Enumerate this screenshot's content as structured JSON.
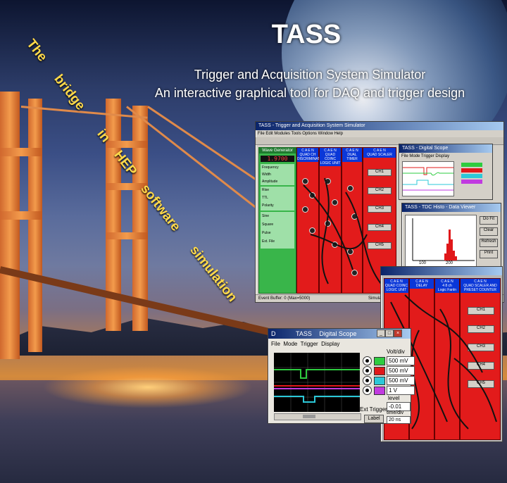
{
  "banner": {
    "title": "TASS",
    "subtitle_line1": "Trigger and Acquisition System Simulator",
    "subtitle_line2": "An interactive graphical tool for DAQ and trigger design",
    "slogan_words": [
      "The",
      "bridge",
      "in",
      "HEP",
      "software",
      "simulation"
    ]
  },
  "main_window": {
    "title": "TASS - Trigger and Acquisition System Simulator",
    "wave_generator_label": "Wave Generator",
    "wave_frequency_display": "1.9700",
    "wave_controls": [
      "Frequency",
      "Width",
      "Amplitude",
      "Rise",
      "TTL",
      "Polarity",
      "Sine",
      "Square",
      "Pulse",
      "Ext. File"
    ],
    "module_headers": [
      "C A E N\nQUAD CH\nDISCRIMINATOR",
      "C A E N\nQUAD COINC\nLOGIC UNIT",
      "C A E N\nDUAL TIMER",
      "C A E N\nQUAD SCALER"
    ],
    "channel_labels": [
      "CH1",
      "CH2",
      "CH3",
      "CH4",
      "CH5"
    ],
    "statusbar": "Event Buffer: 0 (Max=5000)",
    "statusbar_right": "Simulation"
  },
  "scope_window_small": {
    "title": "TASS - Digital Scope",
    "menu": [
      "File",
      "Mode",
      "Trigger",
      "Display"
    ]
  },
  "histogram_window": {
    "title": "TASS - TDC Histo - Data Viewer",
    "buttons": [
      "Do Fit",
      "Clear",
      "Refresh",
      "Print"
    ],
    "axis_ticks": [
      "100",
      "200"
    ]
  },
  "module_window": {
    "module_headers": [
      "C A E N\nQUAD COINC\nLOGIC UNIT",
      "C A E N\nDELAY",
      "C A E N\n4 8 ch\nLogic FanIn",
      "C A E N\nQUAD SCALER AND\nPRESET COUNTER"
    ],
    "channel_labels": [
      "CH1",
      "CH2",
      "CH3",
      "CH4",
      "CH5"
    ]
  },
  "digital_scope": {
    "title": "TASS",
    "title_right": "Digital Scope",
    "title_prefix": "D",
    "menu": [
      "File",
      "Mode",
      "Trigger",
      "Display"
    ],
    "volt_div_label": "Volt/div",
    "channels": [
      {
        "value": "500 mV",
        "color": "#2ecc40"
      },
      {
        "value": "500 mV",
        "color": "#e0181a"
      },
      {
        "value": "500 mV",
        "color": "#2bc8d8"
      },
      {
        "value": "1 V",
        "color": "#c13ae0"
      }
    ],
    "level_label": "level",
    "level_value": "-0.01",
    "time_div_label": "time/div",
    "time_div_value": "20 ns",
    "ext_trigger_label": "Ext Trigger",
    "label_button": "Label"
  }
}
